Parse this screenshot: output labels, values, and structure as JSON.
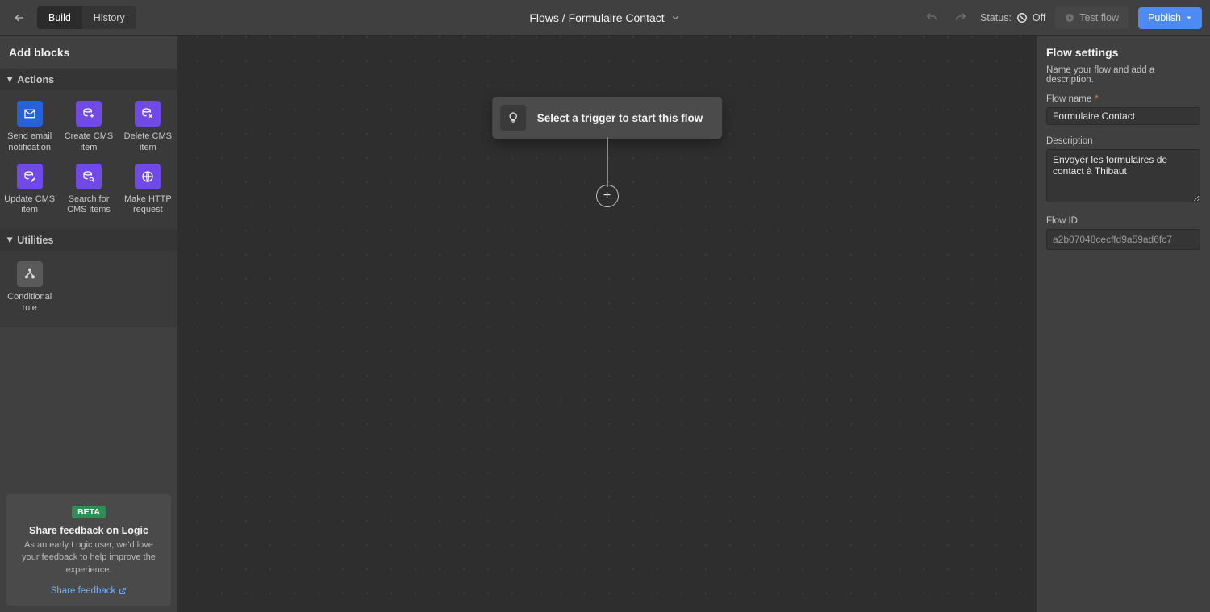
{
  "topbar": {
    "tab_build": "Build",
    "tab_history": "History",
    "title": "Flows / Formulaire Contact",
    "status_label": "Status:",
    "status_value": "Off",
    "test_button": "Test flow",
    "publish_button": "Publish"
  },
  "sidebar": {
    "title": "Add blocks",
    "section_actions": "Actions",
    "section_utilities": "Utilities",
    "blocks": {
      "send_email": "Send email notification",
      "create_cms": "Create CMS item",
      "delete_cms": "Delete CMS item",
      "update_cms": "Update CMS item",
      "search_cms": "Search for CMS items",
      "http": "Make HTTP request",
      "conditional": "Conditional rule"
    },
    "feedback": {
      "badge": "BETA",
      "heading": "Share feedback on Logic",
      "body": "As an early Logic user, we'd love your feedback to help improve the experience.",
      "link": "Share feedback"
    }
  },
  "canvas": {
    "trigger_prompt": "Select a trigger to start this flow"
  },
  "right": {
    "title": "Flow settings",
    "subtitle": "Name your flow and add a description.",
    "name_label": "Flow name",
    "name_value": "Formulaire Contact",
    "desc_label": "Description",
    "desc_value": "Envoyer les formulaires de contact à Thibaut",
    "id_label": "Flow ID",
    "id_value": "a2b07048cecffd9a59ad6fc7"
  }
}
